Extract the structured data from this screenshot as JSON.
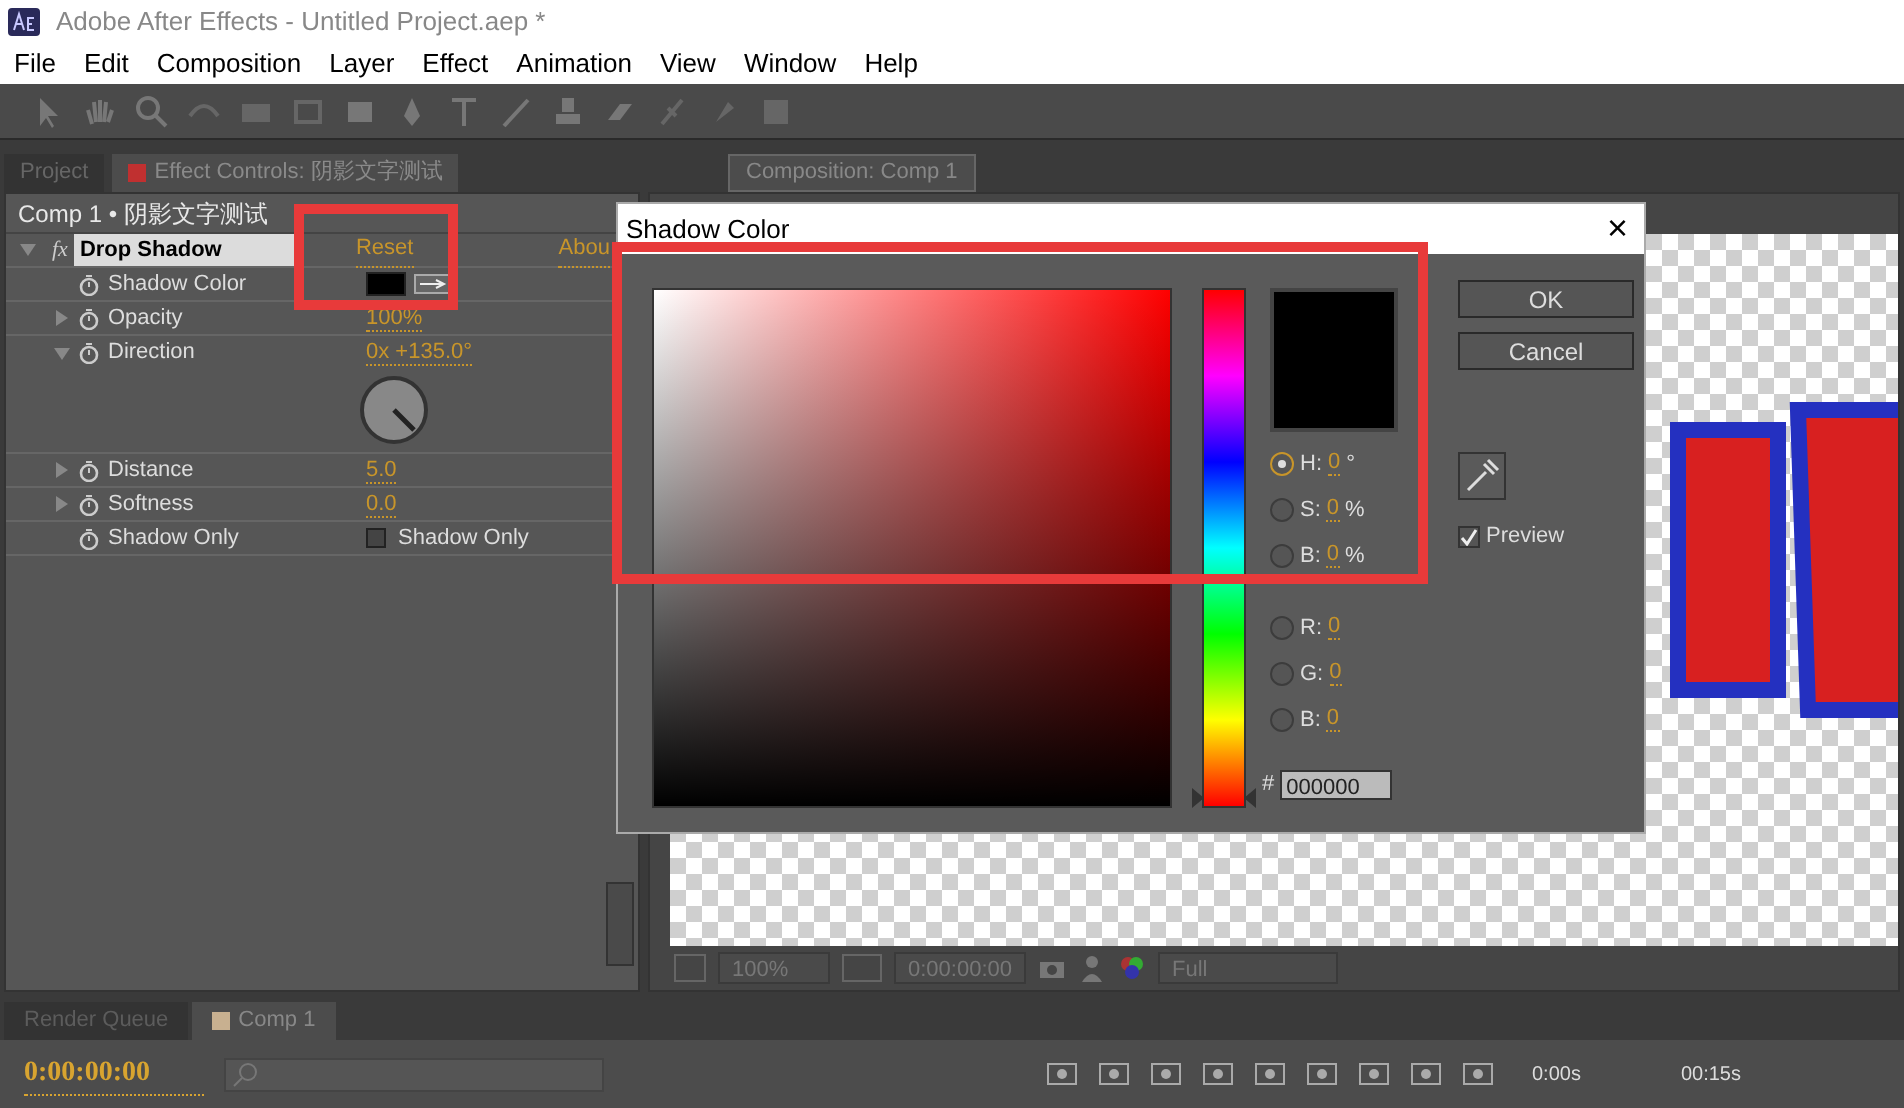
{
  "window": {
    "title": "Adobe After Effects - Untitled Project.aep *"
  },
  "menu": [
    "File",
    "Edit",
    "Composition",
    "Layer",
    "Effect",
    "Animation",
    "View",
    "Window",
    "Help"
  ],
  "left_panel": {
    "tabs": [
      {
        "label": "Project",
        "selected": false
      },
      {
        "label": "Effect Controls: 阴影文字测试",
        "selected": true
      }
    ],
    "header": "Comp 1 • 阴影文字测试",
    "effect": {
      "badge": "fx",
      "name": "Drop Shadow",
      "reset": "Reset",
      "about": "Abou",
      "expanded": true
    },
    "properties": [
      {
        "kind": "color",
        "name": "Shadow Color"
      },
      {
        "kind": "value",
        "name": "Opacity",
        "value": "100%",
        "expanded": false
      },
      {
        "kind": "angle",
        "name": "Direction",
        "value": "0x +135.0°",
        "expanded": true
      },
      {
        "kind": "value",
        "name": "Distance",
        "value": "5.0",
        "expanded": false
      },
      {
        "kind": "value",
        "name": "Softness",
        "value": "0.0",
        "expanded": false
      },
      {
        "kind": "checkbox",
        "name": "Shadow Only",
        "value": "Shadow Only",
        "checked": false
      }
    ]
  },
  "comp_panel": {
    "tab": "Composition: Comp 1",
    "zoom": "100%",
    "timecode": "0:00:00:00",
    "resolution": "Full"
  },
  "dialog": {
    "title": "Shadow Color",
    "close": "×",
    "fields": [
      {
        "label": "H:",
        "value": "0",
        "unit": "°",
        "selected": true
      },
      {
        "label": "S:",
        "value": "0",
        "unit": "%",
        "selected": false
      },
      {
        "label": "B:",
        "value": "0",
        "unit": "%",
        "selected": false
      },
      {
        "label": "R:",
        "value": "0",
        "selected": false
      },
      {
        "label": "G:",
        "value": "0",
        "selected": false
      },
      {
        "label": "B:",
        "value": "0",
        "selected": false
      }
    ],
    "hue_slider": {
      "level": 0
    },
    "hex_label": "#",
    "hex": "000000",
    "buttons": [
      "OK",
      "Cancel"
    ],
    "preview": {
      "label": "Preview",
      "checked": true
    }
  },
  "bottom": {
    "tabs": [
      {
        "label": "Render Queue",
        "selected": false
      },
      {
        "label": "Comp 1",
        "selected": true
      }
    ],
    "timecode": "0:00:00:00",
    "ruler": [
      "0:00s",
      "00:15s"
    ]
  }
}
